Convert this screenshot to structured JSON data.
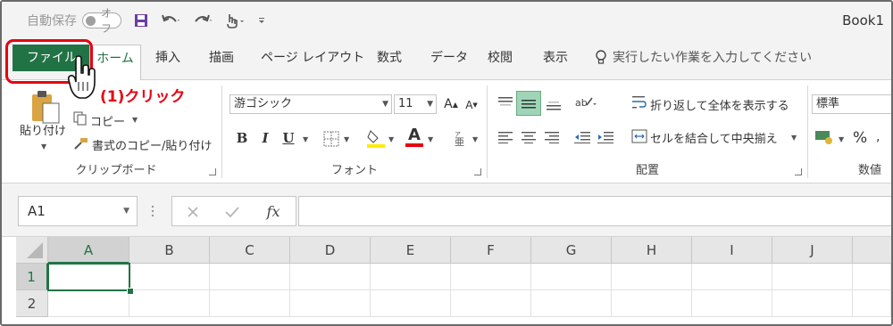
{
  "title_bar": {
    "autosave_label": "自動保存",
    "autosave_state": "オフ",
    "book_title": "Book1"
  },
  "tabs": [
    {
      "label": "ファイル",
      "selected": false,
      "highlight": true
    },
    {
      "label": "ホーム",
      "selected": true
    },
    {
      "label": "挿入"
    },
    {
      "label": "描画"
    },
    {
      "label": "ページ レイアウト"
    },
    {
      "label": "数式"
    },
    {
      "label": "データ"
    },
    {
      "label": "校閲"
    },
    {
      "label": "表示"
    }
  ],
  "tell_me": "実行したい作業を入力してください",
  "annotation": "(1)クリック",
  "ribbon": {
    "clipboard": {
      "paste": "貼り付け",
      "copy": "コピー",
      "format_painter": "書式のコピー/貼り付け",
      "label": "クリップボード"
    },
    "font": {
      "font_name": "游ゴシック",
      "font_size": "11",
      "bold": "B",
      "italic": "I",
      "underline": "U",
      "font_color_letter": "A",
      "label": "フォント"
    },
    "alignment": {
      "wrap_text": "折り返して全体を表示する",
      "merge_center": "セルを結合して中央揃え",
      "label": "配置"
    },
    "number": {
      "format": "標準",
      "percent": "%",
      "label": "数値"
    }
  },
  "formula_bar": {
    "name_box": "A1",
    "fx": "fx",
    "value": ""
  },
  "grid": {
    "columns": [
      "A",
      "B",
      "C",
      "D",
      "E",
      "F",
      "G",
      "H",
      "I",
      "J"
    ],
    "rows": [
      "1",
      "2"
    ],
    "selected_cell": "A1"
  },
  "colors": {
    "accent": "#217346",
    "annotation": "#e60012"
  }
}
